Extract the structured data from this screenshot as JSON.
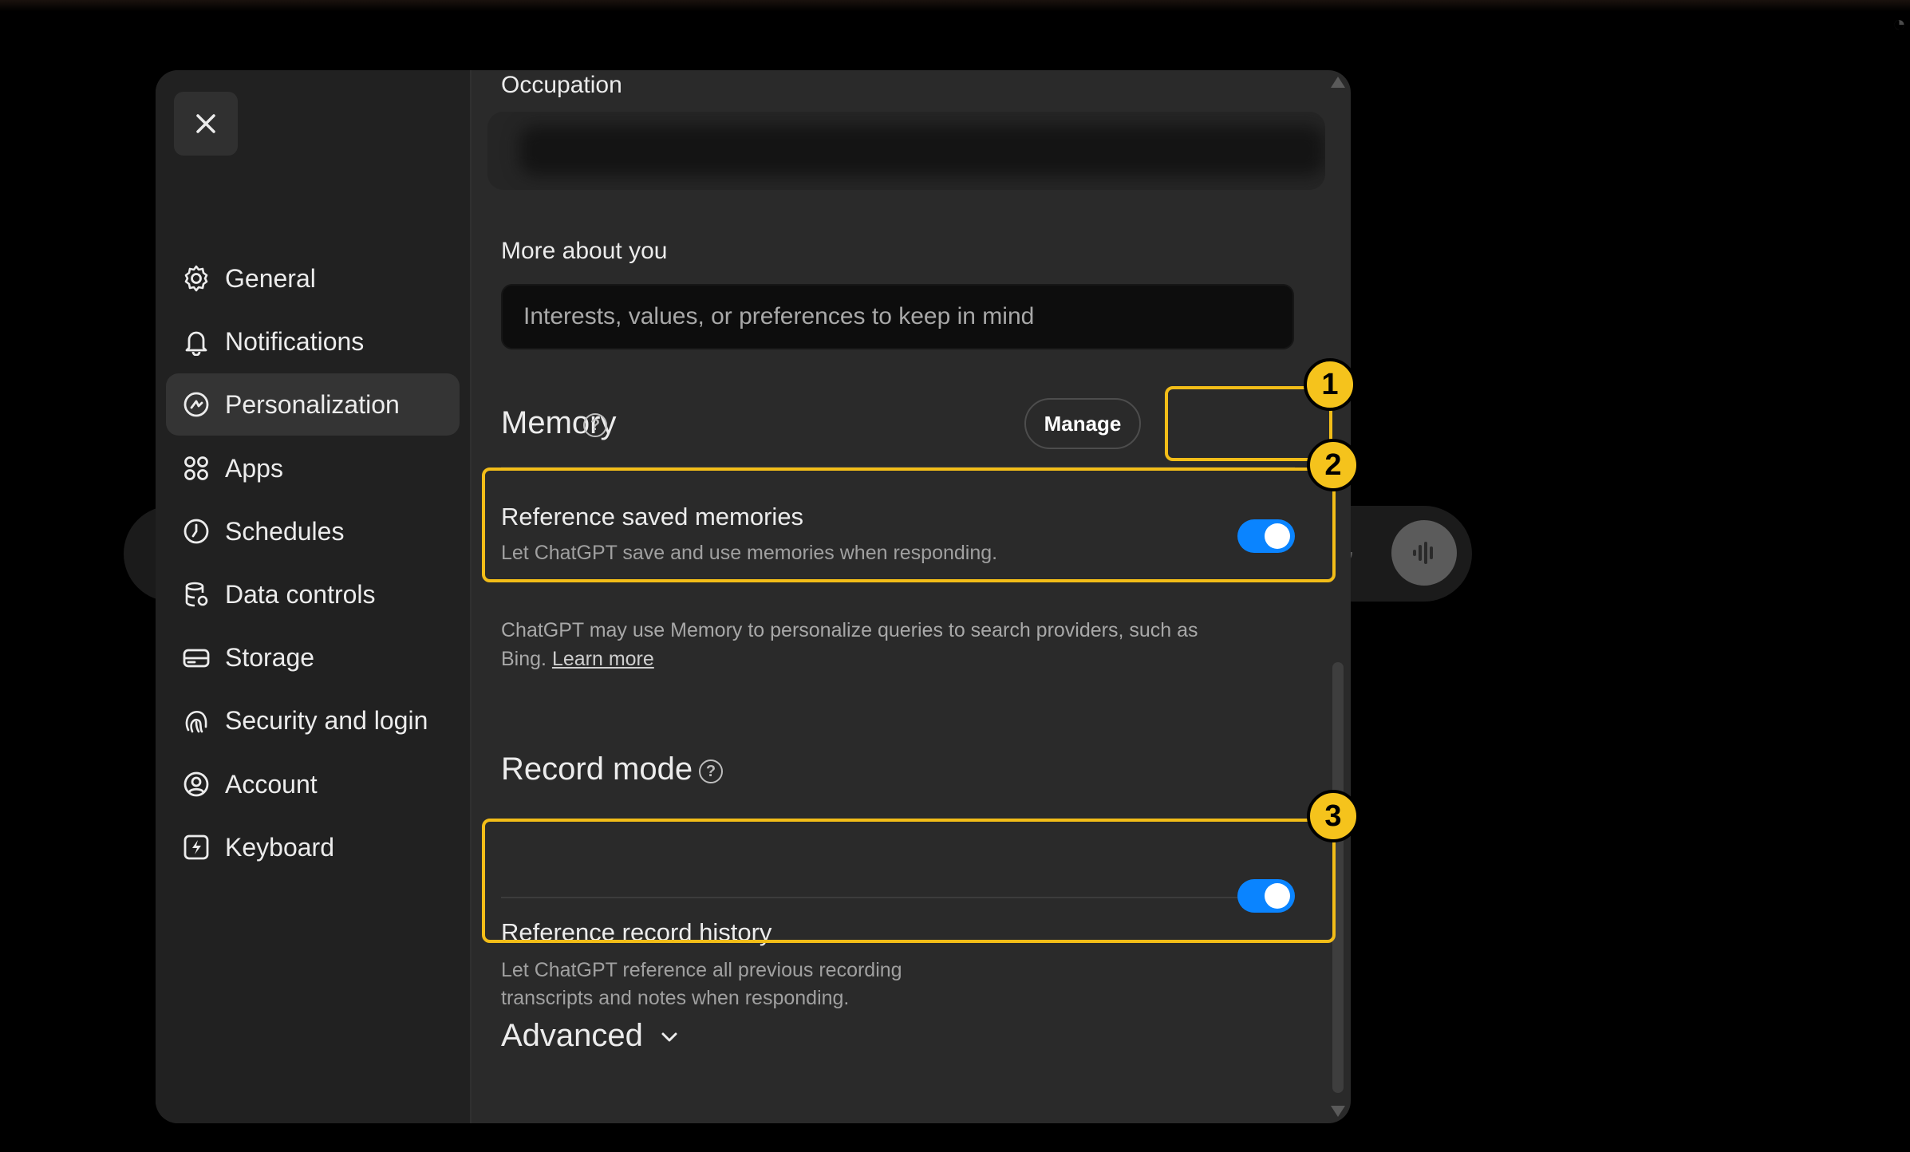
{
  "sidebar": {
    "items": [
      {
        "label": "General",
        "icon": "gear-icon"
      },
      {
        "label": "Notifications",
        "icon": "bell-icon"
      },
      {
        "label": "Personalization",
        "icon": "personalization-icon"
      },
      {
        "label": "Apps",
        "icon": "apps-grid-icon"
      },
      {
        "label": "Schedules",
        "icon": "clock-icon"
      },
      {
        "label": "Data controls",
        "icon": "database-icon"
      },
      {
        "label": "Storage",
        "icon": "storage-icon"
      },
      {
        "label": "Security and login",
        "icon": "fingerprint-icon"
      },
      {
        "label": "Account",
        "icon": "account-icon"
      },
      {
        "label": "Keyboard",
        "icon": "keyboard-icon"
      }
    ],
    "active": "Personalization"
  },
  "content": {
    "occupation_label": "Occupation",
    "more_about_label": "More about you",
    "more_about_placeholder": "Interests, values, or preferences to keep in mind",
    "memory": {
      "title": "Memory",
      "manage_label": "Manage",
      "reference_saved_title": "Reference saved memories",
      "reference_saved_desc": "Let ChatGPT save and use memories when responding.",
      "reference_saved_on": true,
      "note_text": "ChatGPT may use Memory to personalize queries to search providers, such as Bing.",
      "note_link": "Learn more"
    },
    "record_mode": {
      "title": "Record mode",
      "reference_history_title": "Reference record history",
      "reference_history_desc_1": "Let ChatGPT reference all previous recording",
      "reference_history_desc_2": "transcripts and notes when responding.",
      "reference_history_on": true
    },
    "advanced_label": "Advanced"
  },
  "annotations": [
    "1",
    "2",
    "3"
  ],
  "colors": {
    "accent_toggle": "#0a84ff",
    "highlight": "#f2bd18",
    "modal_bg": "#2a2a2a",
    "sidebar_bg": "#212121"
  }
}
